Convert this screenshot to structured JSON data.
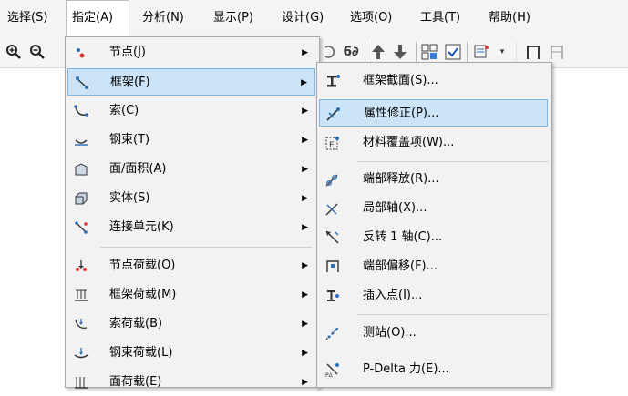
{
  "menubar": {
    "items": [
      {
        "label": "选择(S)"
      },
      {
        "label": "指定(A)"
      },
      {
        "label": "分析(N)"
      },
      {
        "label": "显示(P)"
      },
      {
        "label": "设计(G)"
      },
      {
        "label": "选项(O)"
      },
      {
        "label": "工具(T)"
      },
      {
        "label": "帮助(H)"
      }
    ]
  },
  "toolbar": {
    "icons": [
      "zoom-in-icon",
      "zoom-out-icon",
      "redo-icon",
      "sixty-icon",
      "move-up-icon",
      "move-down-icon",
      "grid-icon",
      "checkbox-icon",
      "assign-icon",
      "frame-icon",
      "frame-alt-icon"
    ]
  },
  "assign_menu": {
    "items": [
      {
        "label": "节点(J)",
        "icon": "joint-icon"
      },
      {
        "label": "框架(F)",
        "icon": "frame-member-icon"
      },
      {
        "label": "索(C)",
        "icon": "cable-icon"
      },
      {
        "label": "钢束(T)",
        "icon": "tendon-icon"
      },
      {
        "label": "面/面积(A)",
        "icon": "area-icon"
      },
      {
        "label": "实体(S)",
        "icon": "solid-icon"
      },
      {
        "label": "连接单元(K)",
        "icon": "link-icon"
      },
      {
        "label": "节点荷载(O)",
        "icon": "joint-load-icon"
      },
      {
        "label": "框架荷载(M)",
        "icon": "frame-load-icon"
      },
      {
        "label": "索荷载(B)",
        "icon": "cable-load-icon"
      },
      {
        "label": "钢束荷载(L)",
        "icon": "tendon-load-icon"
      },
      {
        "label": "面荷载(E)",
        "icon": "area-load-icon"
      }
    ]
  },
  "frame_submenu": {
    "items": [
      {
        "label": "框架截面(S)...",
        "icon": "frame-section-icon"
      },
      {
        "label": "属性修正(P)...",
        "icon": "property-modifier-icon"
      },
      {
        "label": "材料覆盖项(W)...",
        "icon": "material-override-icon"
      },
      {
        "label": "端部释放(R)...",
        "icon": "end-release-icon"
      },
      {
        "label": "局部轴(X)...",
        "icon": "local-axes-icon"
      },
      {
        "label": "反转 1 轴(C)...",
        "icon": "reverse-axis-icon"
      },
      {
        "label": "端部偏移(F)...",
        "icon": "end-offset-icon"
      },
      {
        "label": "插入点(I)...",
        "icon": "insertion-point-icon"
      },
      {
        "label": "测站(O)...",
        "icon": "output-station-icon"
      },
      {
        "label": "P-Delta 力(E)...",
        "icon": "p-delta-icon"
      }
    ]
  }
}
